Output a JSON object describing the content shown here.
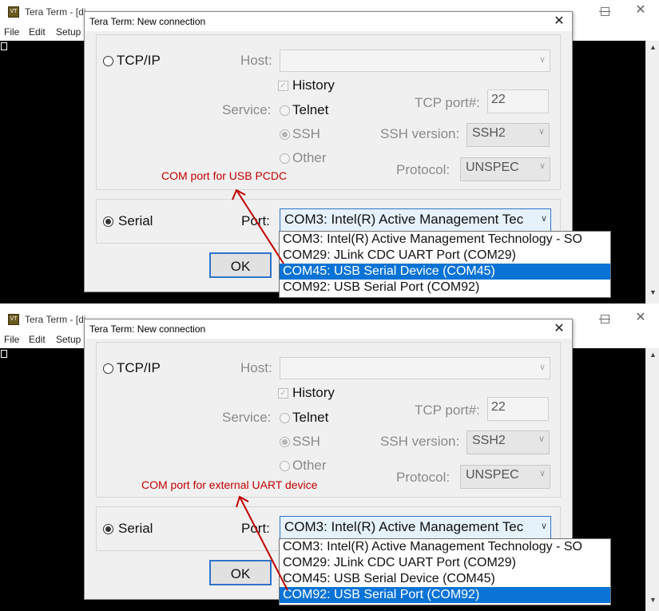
{
  "colors": {
    "terminal_bg": "#000000",
    "dialog_bg": "#f0f0f0",
    "annotation": "#c00000",
    "selection": "#0a73d6",
    "focus_border": "#2f73c8"
  },
  "panels": [
    {
      "bg_window": {
        "title": "Tera Term - [di",
        "menu": [
          "File",
          "Edit",
          "Setup"
        ],
        "icons": [
          "teraterm-logo-icon",
          "minimize-icon",
          "maximize-icon",
          "close-icon",
          "scroll-up-icon",
          "scroll-down-icon"
        ]
      },
      "dialog": {
        "title": "Tera Term: New connection",
        "tcpip_label": "TCP/IP",
        "host_label": "Host:",
        "host_value": "",
        "history_label": "History",
        "service_label": "Service:",
        "telnet_label": "Telnet",
        "ssh_label": "SSH",
        "other_label": "Other",
        "tcp_port_label": "TCP port#:",
        "tcp_port_value": "22",
        "ssh_version_label": "SSH version:",
        "ssh_version_value": "SSH2",
        "protocol_label": "Protocol:",
        "protocol_value": "UNSPEC",
        "serial_label": "Serial",
        "port_label": "Port:",
        "port_value": "COM3: Intel(R) Active Management Tec",
        "ok_label": "OK",
        "serial_selected": true
      },
      "dropdown_items": [
        "COM3: Intel(R) Active Management Technology - SO",
        "COM29: JLink CDC UART Port (COM29)",
        "COM45: USB Serial Device (COM45)",
        "COM92: USB Serial Port (COM92)"
      ],
      "highlighted_item": 2,
      "annotation": "COM port for USB PCDC"
    },
    {
      "bg_window": {
        "title": "Tera Term - [di",
        "menu": [
          "File",
          "Edit",
          "Setup"
        ],
        "icons": [
          "teraterm-logo-icon",
          "minimize-icon",
          "maximize-icon",
          "close-icon",
          "scroll-up-icon",
          "scroll-down-icon"
        ]
      },
      "dialog": {
        "title": "Tera Term: New connection",
        "tcpip_label": "TCP/IP",
        "host_label": "Host:",
        "host_value": "",
        "history_label": "History",
        "service_label": "Service:",
        "telnet_label": "Telnet",
        "ssh_label": "SSH",
        "other_label": "Other",
        "tcp_port_label": "TCP port#:",
        "tcp_port_value": "22",
        "ssh_version_label": "SSH version:",
        "ssh_version_value": "SSH2",
        "protocol_label": "Protocol:",
        "protocol_value": "UNSPEC",
        "serial_label": "Serial",
        "port_label": "Port:",
        "port_value": "COM3: Intel(R) Active Management Tec",
        "ok_label": "OK",
        "serial_selected": true
      },
      "dropdown_items": [
        "COM3: Intel(R) Active Management Technology - SO",
        "COM29: JLink CDC UART Port (COM29)",
        "COM45: USB Serial Device (COM45)",
        "COM92: USB Serial Port (COM92)"
      ],
      "highlighted_item": 3,
      "annotation": "COM port for external UART device"
    }
  ]
}
